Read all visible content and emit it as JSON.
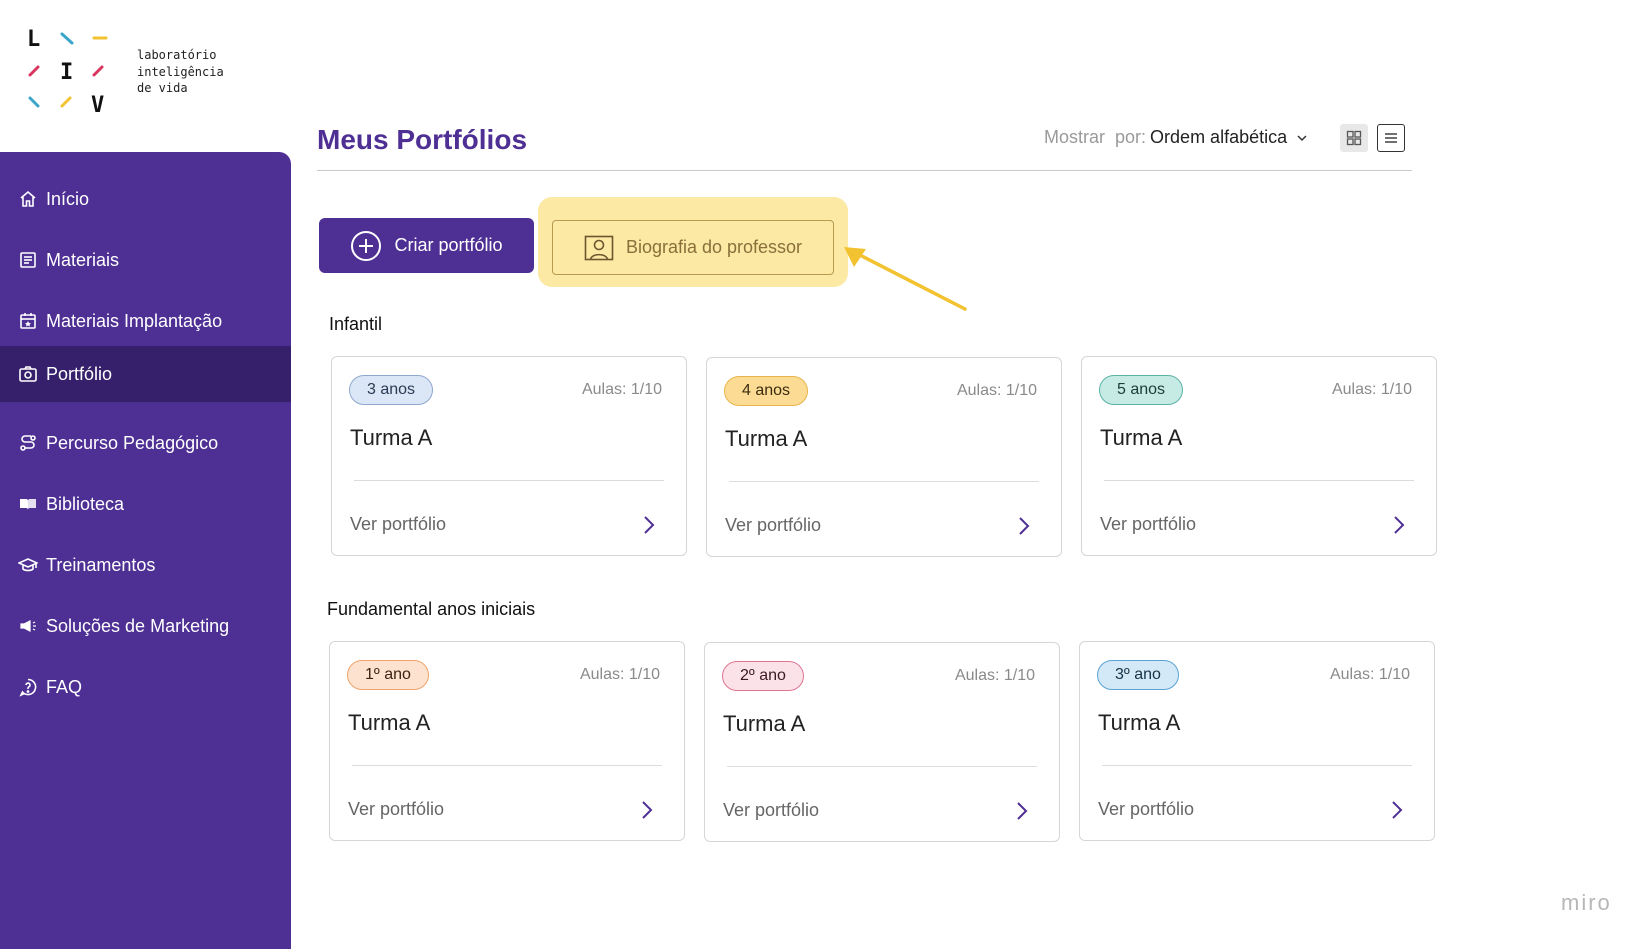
{
  "logo": {
    "letters": [
      "L",
      "I",
      "V"
    ],
    "text": "laboratório\ninteligência\nde vida"
  },
  "sidebar": {
    "items": [
      {
        "label": "Início",
        "icon": "home-icon"
      },
      {
        "label": "Materiais",
        "icon": "document-icon"
      },
      {
        "label": "Materiais Implantação",
        "icon": "calendar-star-icon"
      },
      {
        "label": "Portfólio",
        "icon": "camera-icon",
        "active": true
      },
      {
        "label": "Percurso Pedagógico",
        "icon": "route-icon"
      },
      {
        "label": "Biblioteca",
        "icon": "book-icon"
      },
      {
        "label": "Treinamentos",
        "icon": "graduation-cap-icon"
      },
      {
        "label": "Soluções de Marketing",
        "icon": "megaphone-icon"
      },
      {
        "label": "FAQ",
        "icon": "help-icon"
      }
    ]
  },
  "header": {
    "title": "Meus Portfólios",
    "sort_label_1": "Mostrar",
    "sort_label_2": "por:",
    "sort_value": "Ordem alfabética"
  },
  "actions": {
    "create_label": "Criar portfólio",
    "bio_label": "Biografia do professor"
  },
  "sections": [
    {
      "title": "Infantil",
      "cards": [
        {
          "badge": "3 anos",
          "lessons": "Aulas: 1/10",
          "turma": "Turma A",
          "link": "Ver portfólio",
          "badge_bg": "#dbe6f6",
          "badge_border": "#8fa8cf",
          "badge_color": "#2b3b55"
        },
        {
          "badge": "4 anos",
          "lessons": "Aulas: 1/10",
          "turma": "Turma A",
          "link": "Ver portfólio",
          "badge_bg": "#fcdc94",
          "badge_border": "#e6b44a",
          "badge_color": "#3b2c0e"
        },
        {
          "badge": "5 anos",
          "lessons": "Aulas: 1/10",
          "turma": "Turma A",
          "link": "Ver portfólio",
          "badge_bg": "#c6eae4",
          "badge_border": "#5bb3a5",
          "badge_color": "#1d3d38"
        }
      ]
    },
    {
      "title": "Fundamental anos iniciais",
      "cards": [
        {
          "badge": "1º ano",
          "lessons": "Aulas: 1/10",
          "turma": "Turma A",
          "link": "Ver portfólio",
          "badge_bg": "#fde3cf",
          "badge_border": "#f0a36a",
          "badge_color": "#3b2414"
        },
        {
          "badge": "2º ano",
          "lessons": "Aulas: 1/10",
          "turma": "Turma A",
          "link": "Ver portfólio",
          "badge_bg": "#fbe1e8",
          "badge_border": "#e37593",
          "badge_color": "#3b1a22"
        },
        {
          "badge": "3º ano",
          "lessons": "Aulas: 1/10",
          "turma": "Turma A",
          "link": "Ver portfólio",
          "badge_bg": "#d4e9f7",
          "badge_border": "#5aa2d3",
          "badge_color": "#173347"
        }
      ]
    }
  ],
  "watermark": "miro",
  "colors": {
    "brand": "#4e2f94",
    "active_nav": "#36206b",
    "highlight": "#fbe9a4",
    "arrow": "#f2c230"
  }
}
